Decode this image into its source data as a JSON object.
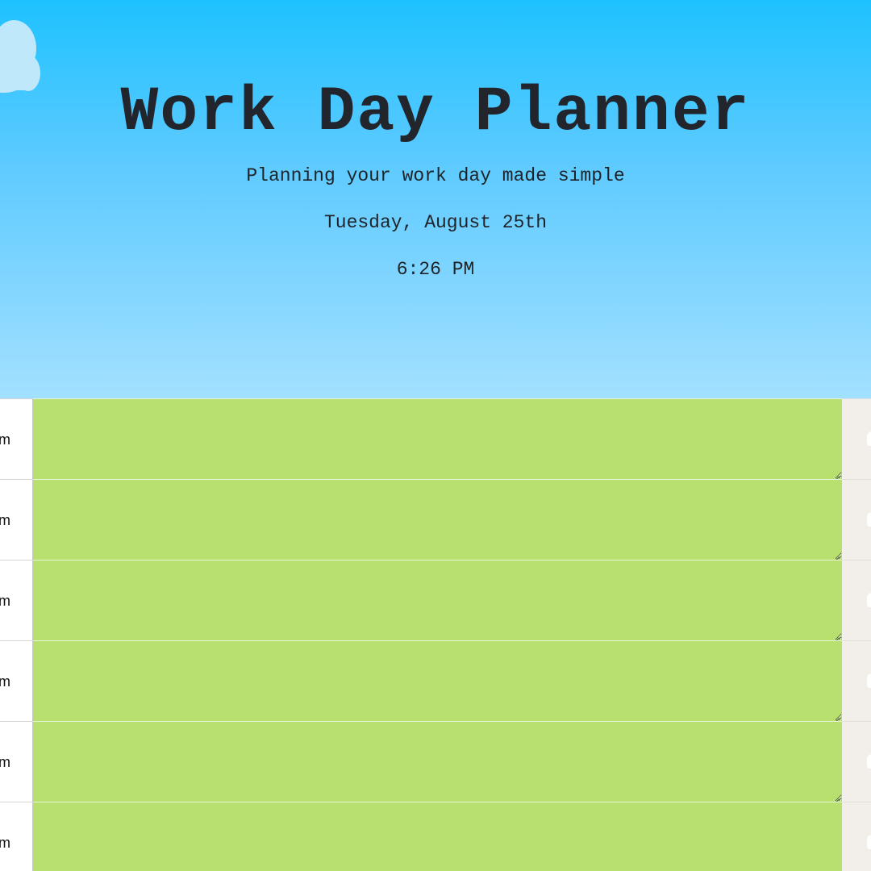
{
  "header": {
    "title": "Work Day Planner",
    "subtitle": "Planning your work day made simple",
    "date": "Tuesday, August 25th",
    "time": "6:26 PM"
  },
  "timeblocks": [
    {
      "hour": "m",
      "task": "",
      "status": "future"
    },
    {
      "hour": "m",
      "task": "",
      "status": "future"
    },
    {
      "hour": "m",
      "task": "",
      "status": "future"
    },
    {
      "hour": "m",
      "task": "",
      "status": "future"
    },
    {
      "hour": "m",
      "task": "",
      "status": "future"
    },
    {
      "hour": "m",
      "task": "",
      "status": "future"
    }
  ],
  "colors": {
    "future": "#b8e06e",
    "save_button": "#f2efeb",
    "header_top": "#1ec2ff",
    "header_bottom": "#a3e0ff"
  },
  "icons": {
    "cloud": "cloud-icon",
    "save": "save-icon"
  }
}
